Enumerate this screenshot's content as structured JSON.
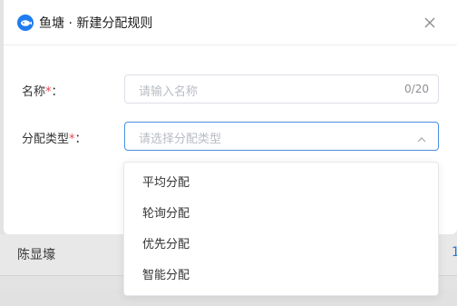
{
  "dialog": {
    "title": "鱼塘 · 新建分配规则",
    "fields": {
      "name_label": "名称",
      "name_placeholder": "请输入名称",
      "name_counter": "0/20",
      "type_label": "分配类型",
      "type_placeholder": "请选择分配类型",
      "required_mark": "*",
      "colon": "："
    }
  },
  "dropdown": {
    "options": [
      "平均分配",
      "轮询分配",
      "优先分配",
      "智能分配"
    ]
  },
  "background": {
    "row_name": "陈显壕",
    "row_right": "1"
  },
  "colors": {
    "accent": "#4a90e2",
    "logo": "#1f7cf0",
    "required": "#e5484d"
  }
}
